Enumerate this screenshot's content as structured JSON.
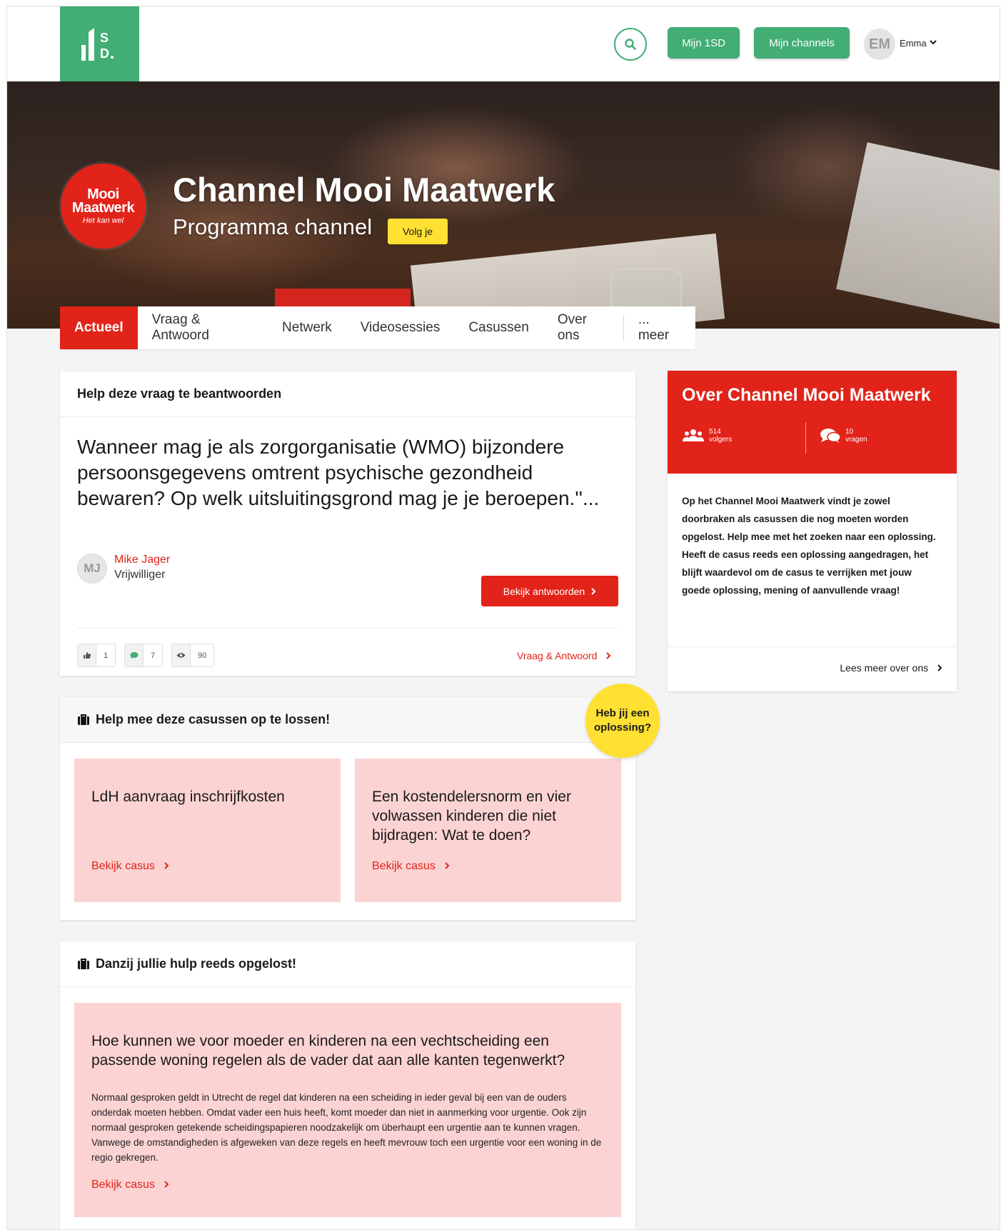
{
  "header": {
    "logo_text": "1SD.",
    "mijn1sd_label": "Mijn 1SD",
    "channels_label": "Mijn channels",
    "user_initials": "EM",
    "user_name": "Emma"
  },
  "hero": {
    "logo_line1": "Mooi",
    "logo_line2": "Maatwerk",
    "logo_tagline": "Het kan wel",
    "title": "Channel Mooi Maatwerk",
    "subtitle": "Programma channel",
    "follow_label": "Volg je"
  },
  "tabs": [
    {
      "label": "Actueel",
      "active": true
    },
    {
      "label": "Vraag & Antwoord"
    },
    {
      "label": "Netwerk"
    },
    {
      "label": "Videosessies"
    },
    {
      "label": "Casussen"
    },
    {
      "label": "Over ons"
    },
    {
      "label": "... meer"
    }
  ],
  "question": {
    "heading": "Help deze vraag te beantwoorden",
    "title": "Wanneer mag je als zorgorganisatie (WMO) bijzondere persoonsgegevens omtrent psychische gezondheid bewaren? Op welk uitsluitingsgrond mag je je beroepen.''...",
    "author_initials": "MJ",
    "author_name": "Mike Jager",
    "author_role": "Vrijwilliger",
    "button_label": "Bekijk antwoorden",
    "likes": "1",
    "comments": "7",
    "views": "90",
    "link_label": "Vraag & Antwoord"
  },
  "solutions": {
    "heading": "Help mee deze casussen op te lossen!",
    "badge_line1": "Heb jij een",
    "badge_line2": "oplossing?",
    "cases": [
      {
        "title": "LdH aanvraag inschrijfkosten",
        "link": "Bekijk casus"
      },
      {
        "title": "Een kostendelersnorm en vier volwassen kinderen die niet bijdragen: Wat te doen?",
        "link": "Bekijk casus"
      }
    ]
  },
  "solved": {
    "heading": "Danzij jullie hulp reeds opgelost!",
    "title": "Hoe kunnen we voor moeder en kinderen na een vechtscheiding een passende woning regelen als de vader dat aan alle kanten tegenwerkt?",
    "body": "Normaal gesproken geldt in Utrecht de regel dat kinderen na een scheiding in ieder geval bij een van de ouders onderdak moeten hebben. Omdat vader een huis heeft, komt moeder dan niet in aanmerking voor urgentie. Ook zijn normaal gesproken getekende scheidingspapieren noodzakelijk om überhaupt een urgentie aan te kunnen vragen. Vanwege de omstandigheden is afgeweken van deze regels en heeft mevrouw toch een urgentie voor een woning in de regio gekregen.",
    "link": "Bekijk casus"
  },
  "about": {
    "title": "Over Channel Mooi Maatwerk",
    "followers_count": "514",
    "followers_label": "volgers",
    "questions_count": "10",
    "questions_label": "vragen",
    "body": "Op het Channel Mooi Maatwerk vindt je zowel doorbraken als casussen die nog moeten worden opgelost. Help mee met het zoeken naar een oplossing. Heeft de casus reeds een oplossing aangedragen, het blijft waardevol om de casus te verrijken met jouw goede oplossing, mening of aanvullende vraag!",
    "link_label": "Lees meer over ons"
  },
  "colors": {
    "brand_green": "#42ad74",
    "brand_red": "#e2231a",
    "case_pink": "#fcd3d3",
    "accent_yellow": "#ffe033"
  }
}
